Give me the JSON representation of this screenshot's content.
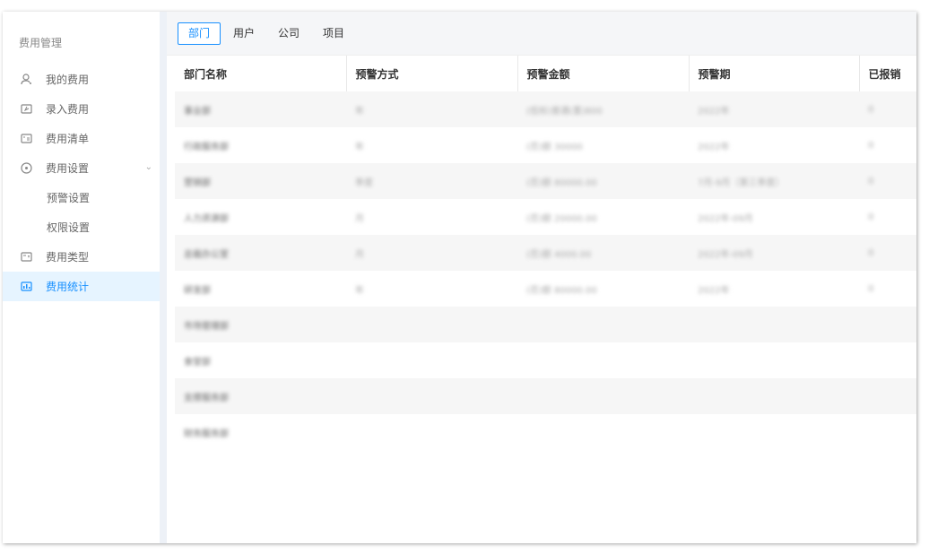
{
  "sidebar": {
    "title": "费用管理",
    "items": [
      {
        "label": "我的费用",
        "icon": "user-icon"
      },
      {
        "label": "录入费用",
        "icon": "entry-icon"
      },
      {
        "label": "费用清单",
        "icon": "list-icon"
      },
      {
        "label": "费用设置",
        "icon": "settings-icon"
      },
      {
        "label": "预警设置"
      },
      {
        "label": "权限设置"
      },
      {
        "label": "费用类型",
        "icon": "category-icon"
      },
      {
        "label": "费用统计",
        "icon": "stats-icon"
      }
    ],
    "active_color": "#1890ff"
  },
  "tabs": [
    {
      "label": "部门",
      "active": true
    },
    {
      "label": "用户"
    },
    {
      "label": "公司"
    },
    {
      "label": "项目"
    }
  ],
  "table": {
    "headers": [
      "部门名称",
      "预警方式",
      "预警金额",
      "预警期",
      "已报销"
    ],
    "rows": [
      [
        "事业部",
        "年",
        "(低标)普通(重)800",
        "2022年",
        "0"
      ],
      [
        "行政服务部",
        "年",
        "(否)额 30000",
        "2022年",
        "0"
      ],
      [
        "营销部",
        "季度",
        "(否)额 80000.00",
        "7月-9月（第三季度）",
        "0"
      ],
      [
        "人力资源部",
        "月",
        "(否)额 20000.00",
        "2022年-09月",
        "0"
      ],
      [
        "总裁办公室",
        "月",
        "(否)额 4000.00",
        "2022年-09月",
        "0"
      ],
      [
        "研发部",
        "年",
        "(否)额 80000.00",
        "2022年",
        "0"
      ],
      [
        "市场管理部",
        "",
        "",
        "",
        ""
      ],
      [
        "食堂部",
        "",
        "",
        "",
        ""
      ],
      [
        "支撑服务部",
        "",
        "",
        "",
        ""
      ],
      [
        "财务服务部",
        "",
        "",
        "",
        ""
      ]
    ]
  }
}
